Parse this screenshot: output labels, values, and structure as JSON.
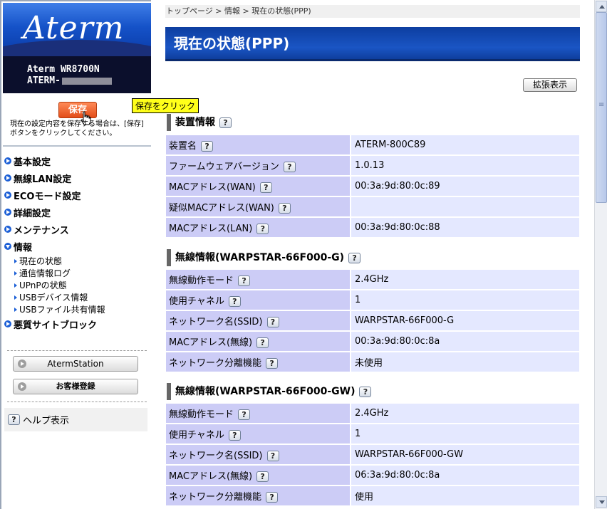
{
  "sidebar": {
    "logo_text": "Aterm",
    "model_line1": "Aterm WR8700N",
    "model_line2": "ATERM-",
    "save_button": "保存",
    "save_note": "現在の設定内容を保存する場合は、[保存]ボタンをクリックしてください。",
    "tooltip": "保存をクリック",
    "menu": [
      {
        "label": "基本設定"
      },
      {
        "label": "無線LAN設定"
      },
      {
        "label": "ECOモード設定"
      },
      {
        "label": "詳細設定"
      },
      {
        "label": "メンテナンス"
      },
      {
        "label": "情報",
        "expanded": true,
        "children": [
          "現在の状態",
          "通信情報ログ",
          "UPnPの状態",
          "USBデバイス情報",
          "USBファイル共有情報"
        ]
      },
      {
        "label": "悪質サイトブロック"
      }
    ],
    "aterm_station": "AtermStation",
    "register": "お客様登録",
    "help": "ヘルプ表示",
    "help_icon": "?"
  },
  "main": {
    "breadcrumb": "トップページ > 情報 > 現在の状態(PPP)",
    "title": "現在の状態(PPP)",
    "expand_button": "拡張表示",
    "sections": [
      {
        "title": "装置情報",
        "rows": [
          {
            "label": "装置名",
            "value": "ATERM-800C89"
          },
          {
            "label": "ファームウェアバージョン",
            "value": "1.0.13"
          },
          {
            "label": "MACアドレス(WAN)",
            "value": "00:3a:9d:80:0c:89"
          },
          {
            "label": "疑似MACアドレス(WAN)",
            "value": ""
          },
          {
            "label": "MACアドレス(LAN)",
            "value": "00:3a:9d:80:0c:88"
          }
        ]
      },
      {
        "title": "無線情報(WARPSTAR-66F000-G)",
        "rows": [
          {
            "label": "無線動作モード",
            "value": "2.4GHz"
          },
          {
            "label": "使用チャネル",
            "value": "1"
          },
          {
            "label": "ネットワーク名(SSID)",
            "value": "WARPSTAR-66F000-G"
          },
          {
            "label": "MACアドレス(無線)",
            "value": "00:3a:9d:80:0c:8a"
          },
          {
            "label": "ネットワーク分離機能",
            "value": "未使用"
          }
        ]
      },
      {
        "title": "無線情報(WARPSTAR-66F000-GW)",
        "rows": [
          {
            "label": "無線動作モード",
            "value": "2.4GHz"
          },
          {
            "label": "使用チャネル",
            "value": "1"
          },
          {
            "label": "ネットワーク名(SSID)",
            "value": "WARPSTAR-66F000-GW"
          },
          {
            "label": "MACアドレス(無線)",
            "value": "06:3a:9d:80:0c:8a"
          },
          {
            "label": "ネットワーク分離機能",
            "value": "使用"
          }
        ]
      }
    ]
  },
  "colors": {
    "title_bar": "#1a55c4",
    "label_cell": "#ccccf6",
    "value_cell": "#e4e8ff",
    "save_button": "#e24d19",
    "tooltip": "#ffff1a"
  }
}
